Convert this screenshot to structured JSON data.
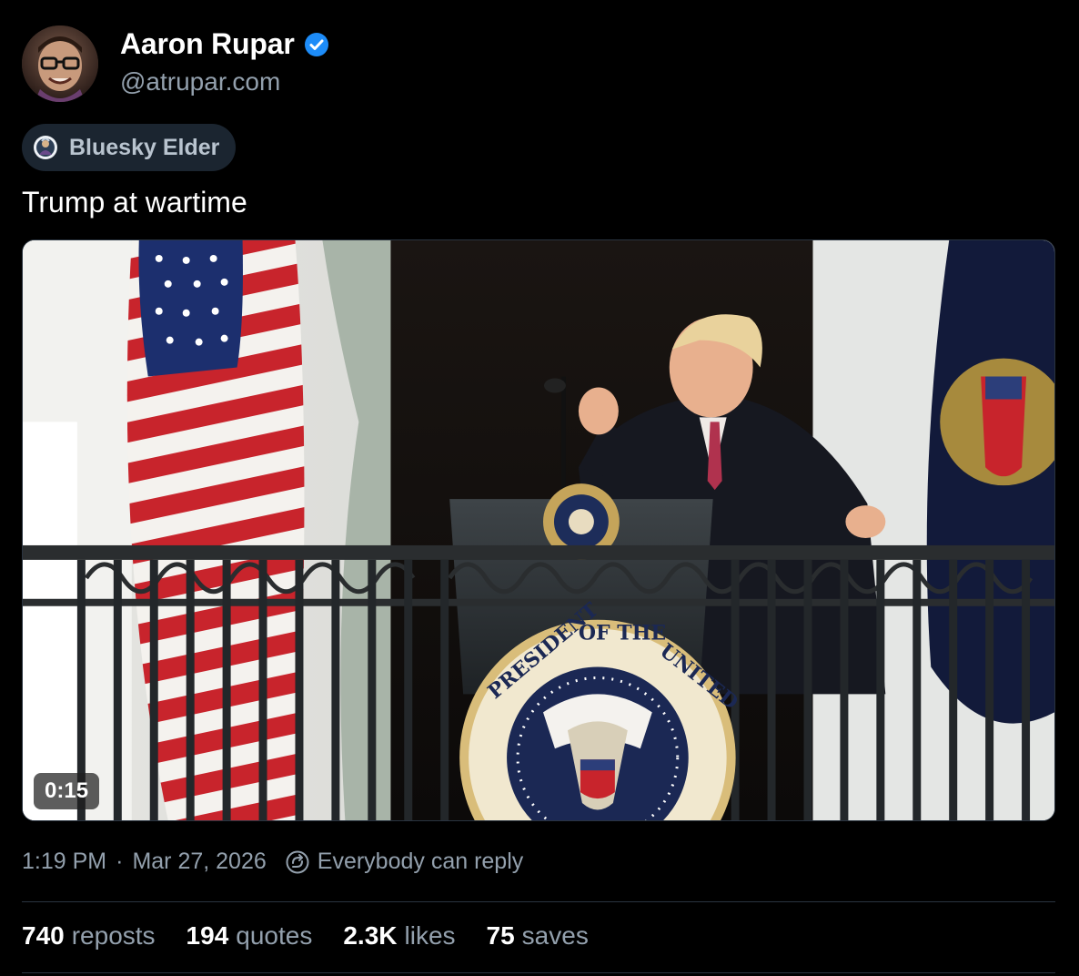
{
  "author": {
    "display_name": "Aaron Rupar",
    "handle": "@atrupar.com",
    "verified_icon": "verified-check-icon",
    "verified_color": "#1d8cf8"
  },
  "badge": {
    "label": "Bluesky Elder",
    "icon": "bluesky-elder-icon"
  },
  "post": {
    "text": "Trump at wartime"
  },
  "media": {
    "type": "video",
    "duration": "0:15",
    "seal_text": "THE PRESIDENT OF THE UNITED STATES"
  },
  "meta": {
    "time": "1:19 PM",
    "separator": "·",
    "date": "Mar 27, 2026",
    "reply_setting": "Everybody can reply",
    "reply_icon": "reply-restriction-icon"
  },
  "stats": {
    "reposts": {
      "count": "740",
      "label": "reposts"
    },
    "quotes": {
      "count": "194",
      "label": "quotes"
    },
    "likes": {
      "count": "2.3K",
      "label": "likes"
    },
    "saves": {
      "count": "75",
      "label": "saves"
    }
  },
  "colors": {
    "background": "#000000",
    "muted_text": "#93a0ad",
    "divider": "#2a3440",
    "badge_bg": "#1b2530"
  }
}
